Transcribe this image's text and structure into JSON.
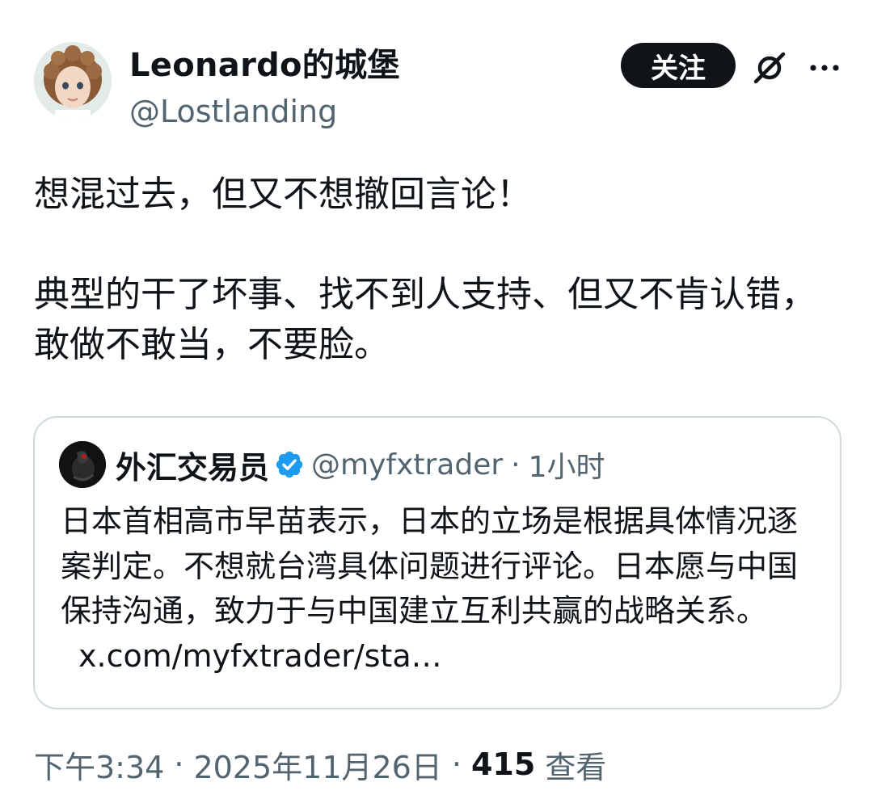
{
  "author": {
    "display_name": "Leonardo的城堡",
    "handle": "@Lostlanding"
  },
  "actions": {
    "follow_label": "关注",
    "grok_icon": "grok-icon",
    "more_icon": "more-icon"
  },
  "tweet": {
    "paragraphs": [
      "想混过去，但又不想撤回言论！",
      "典型的干了坏事、找不到人支持、但又不肯认错，敢做不敢当，不要脸。"
    ]
  },
  "quote": {
    "name": "外汇交易员",
    "verified_icon": "verified-badge-icon",
    "handle": "@myfxtrader",
    "separator": "·",
    "time": "1小时",
    "text": "日本首相高市早苗表示，日本的立场是根据具体情况逐案判定。不想就台湾具体问题进行评论。日本愿与中国保持沟通，致力于与中国建立互利共赢的战略关系。",
    "link": "x.com/myfxtrader/sta…"
  },
  "meta": {
    "time": "下午3:34",
    "separator": "·",
    "date": "2025年11月26日",
    "views_count": "415",
    "views_label": "查看"
  },
  "colors": {
    "text_primary": "#0f1419",
    "text_secondary": "#536471",
    "border": "#cfd9de",
    "verified_blue": "#1d9bf0",
    "follow_bg": "#0f1419"
  }
}
